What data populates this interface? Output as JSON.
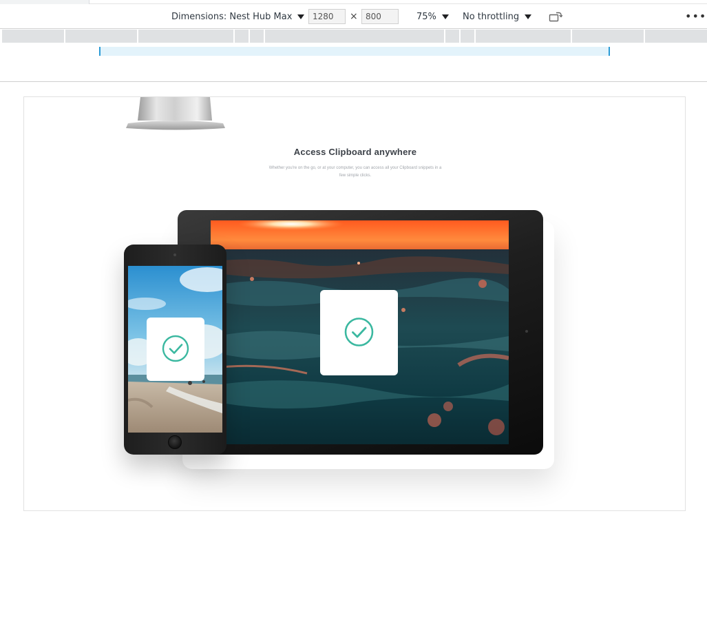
{
  "toolbar": {
    "dimensions_label": "Dimensions: Nest Hub Max",
    "width_value": "1280",
    "times_symbol": "×",
    "height_value": "800",
    "zoom_label": "75%",
    "throttling_label": "No throttling",
    "rotate_icon": "rotate-icon",
    "more_icon": "more-options-icon",
    "more_glyph": "⋮"
  },
  "page": {
    "title": "Access Clipboard anywhere",
    "subtitle": "Whether you're on the go, or at your computer, you can access all your Clipboard snippets in a few simple clicks."
  },
  "colors": {
    "check_accent": "#3bb8a0",
    "ruler_accent": "#2a9bd6"
  }
}
